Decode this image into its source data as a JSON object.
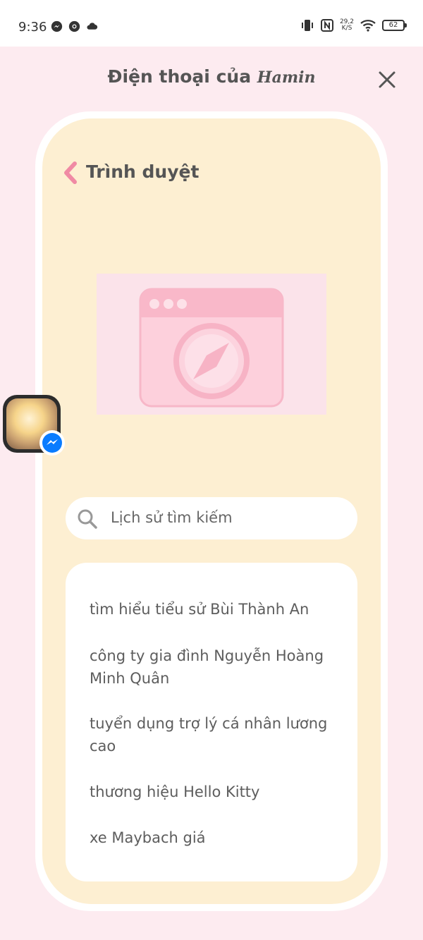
{
  "status_bar": {
    "time": "9:36",
    "network_speed_value": "29,2",
    "network_speed_unit": "K/S",
    "battery": "62"
  },
  "header": {
    "title_prefix": "Điện thoại của",
    "owner_name": "Hamin"
  },
  "browser": {
    "title": "Trình duyệt",
    "search_placeholder": "Lịch sử tìm kiếm",
    "history": [
      "tìm hiểu tiểu sử Bùi Thành An",
      "công ty gia đình Nguyễn Hoàng Minh Quân",
      "tuyển dụng trợ lý cá nhân lương cao",
      "thương hiệu Hello Kitty",
      "xe Maybach giá"
    ]
  },
  "colors": {
    "background": "#fdebf0",
    "phone_fill": "#fdefd2",
    "accent_pink": "#f08aa4",
    "messenger_blue": "#0a7cff"
  }
}
